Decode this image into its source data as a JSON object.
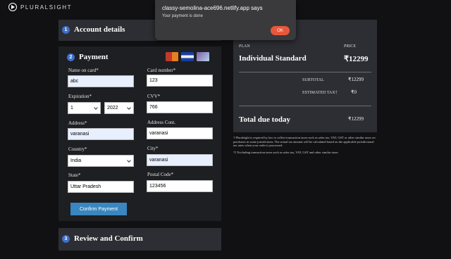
{
  "brand": {
    "logo_text": "PLURALSIGHT"
  },
  "dialog": {
    "title": "classy-semolina-ace696.netlify.app says",
    "message": "Your payment is done",
    "ok_label": "OK"
  },
  "steps": {
    "account": {
      "num": "1",
      "title": "Account details"
    },
    "payment": {
      "num": "2",
      "title": "Payment"
    },
    "review": {
      "num": "3",
      "title": "Review and Confirm"
    }
  },
  "payment_form": {
    "name_label": "Name on card*",
    "name_value": "abc",
    "card_label": "Card number*",
    "card_value": "123",
    "expiration_label": "Expiration*",
    "exp_month": "1",
    "exp_year": "2022",
    "cvv_label": "CVV*",
    "cvv_value": "766",
    "address_label": "Address*",
    "address_value": "varanasi",
    "address_cont_label": "Address Cont.",
    "address_cont_value": "varanasi",
    "country_label": "Country*",
    "country_value": "India",
    "city_label": "City*",
    "city_value": "varanasi",
    "state_label": "State*",
    "state_value": "Uttar Pradesh",
    "postal_label": "Postal Code*",
    "postal_value": "123456",
    "confirm_label": "Confirm Payment"
  },
  "summary": {
    "plan_header": "PLAN",
    "price_header": "PRICE",
    "plan_name": "Individual Standard",
    "plan_price": "₹12299",
    "subtotal_label": "SUBTOTAL",
    "subtotal_value": "₹12299",
    "tax_label": "ESTIMATED TAX†",
    "tax_value": "₹0",
    "total_label": "Total due today",
    "total_value": "₹12299"
  },
  "notes": {
    "note1": "† Pluralsight is required by law to collect transaction taxes such as sales tax, VAT, GST or other similar taxes on purchases in some jurisdictions. The actual tax amount will be calculated based on the applicable jurisdictional tax rates when your order is processed.",
    "note2": "†† Excluding transaction taxes such as sales tax, VAT, GST and other similar taxes"
  }
}
